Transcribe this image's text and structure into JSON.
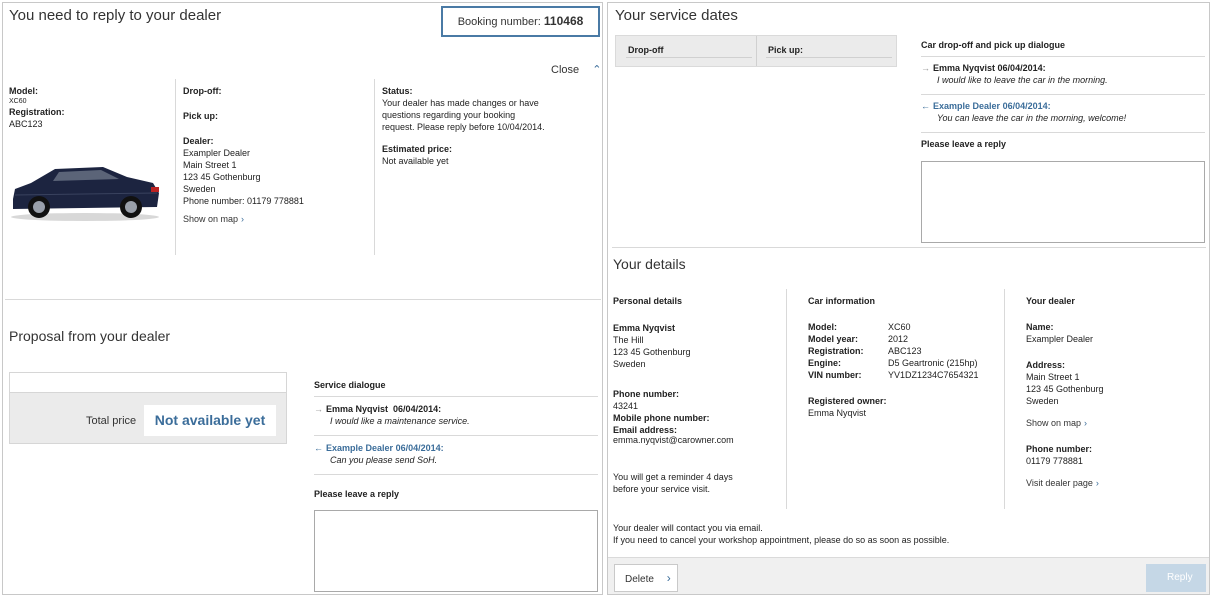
{
  "left": {
    "title": "You need to reply to your dealer",
    "booking_label": "Booking number:",
    "booking_number": "110468",
    "close_label": "Close",
    "car": {
      "model_label": "Model:",
      "model_value": "XC60",
      "registration_label": "Registration:",
      "registration_value": "ABC123"
    },
    "dropoff_label": "Drop-off:",
    "pickup_label": "Pick up:",
    "dealer_label": "Dealer:",
    "dealer_lines": [
      "Exampler Dealer",
      "Main Street 1",
      "123 45 Gothenburg",
      "Sweden",
      "Phone number: 01179 778881"
    ],
    "show_on_map": "Show on map",
    "status_label": "Status:",
    "status_text": "Your dealer has made changes or have questions regarding your booking request. Please reply before 10/04/2014.",
    "estimated_label": "Estimated price:",
    "estimated_value": "Not available yet",
    "proposal_title": "Proposal from your dealer",
    "total_price_label": "Total price",
    "total_price_value": "Not available yet",
    "service_dialogue_label": "Service dialogue",
    "dialogue": [
      {
        "name": "Emma Nyqvist",
        "date": "06/04/2014:",
        "message": "I would like a maintenance service."
      },
      {
        "name": "Example Dealer",
        "date": "06/04/2014:",
        "message": "Can you please send SoH."
      }
    ],
    "reply_label": "Please leave a reply"
  },
  "right": {
    "service_dates_title": "Your service dates",
    "dropoff_label": "Drop-off",
    "pickup_label": "Pick up:",
    "dialogue_title": "Car drop-off and pick up dialogue",
    "dialogue": [
      {
        "name": "Emma Nyqvist",
        "date": "06/04/2014:",
        "message": "I would like to leave the car in the morning."
      },
      {
        "name": "Example Dealer",
        "date": "06/04/2014:",
        "message": "You can leave the car in the morning, welcome!"
      }
    ],
    "reply_label": "Please leave a reply",
    "details_title": "Your details",
    "personal": {
      "heading": "Personal details",
      "name": "Emma Nyqvist",
      "address_lines": [
        "The Hill",
        "123 45 Gothenburg",
        "Sweden"
      ],
      "phone_label": "Phone number:",
      "phone_value": "43241",
      "mobile_label": "Mobile phone number:",
      "email_label": "Email address:",
      "email_value": "emma.nyqvist@carowner.com",
      "reminder": "You will get a reminder 4 days before your service visit."
    },
    "car_info": {
      "heading": "Car information",
      "rows": [
        {
          "label": "Model:",
          "value": "XC60"
        },
        {
          "label": "Model year:",
          "value": "2012"
        },
        {
          "label": "Registration:",
          "value": "ABC123"
        },
        {
          "label": "Engine:",
          "value": "D5 Geartronic (215hp)"
        },
        {
          "label": "VIN number:",
          "value": "YV1DZ1234C7654321"
        }
      ],
      "owner_label": "Registered owner:",
      "owner_value": "Emma Nyqvist"
    },
    "dealer": {
      "heading": "Your dealer",
      "name_label": "Name:",
      "name_value": "Exampler Dealer",
      "address_label": "Address:",
      "address_lines": [
        "Main Street 1",
        "123 45 Gothenburg",
        "Sweden"
      ],
      "show_on_map": "Show on map",
      "phone_label": "Phone number:",
      "phone_value": "01179 778881",
      "visit_page": "Visit dealer page"
    },
    "footer_note_1": "Your dealer will contact you via email.",
    "footer_note_2": "If you need to cancel your workshop appointment, please do so as soon as possible.",
    "delete_label": "Delete",
    "reply_button_label": "Reply"
  },
  "colors": {
    "accent_blue": "#3b6d9a",
    "booking_border": "#4a7aa5",
    "reply_disabled": "#c5d7e6"
  },
  "icons": [
    "chevron-up-icon",
    "chevron-right-icon",
    "arrow-right-icon",
    "arrow-left-icon",
    "car-image"
  ]
}
